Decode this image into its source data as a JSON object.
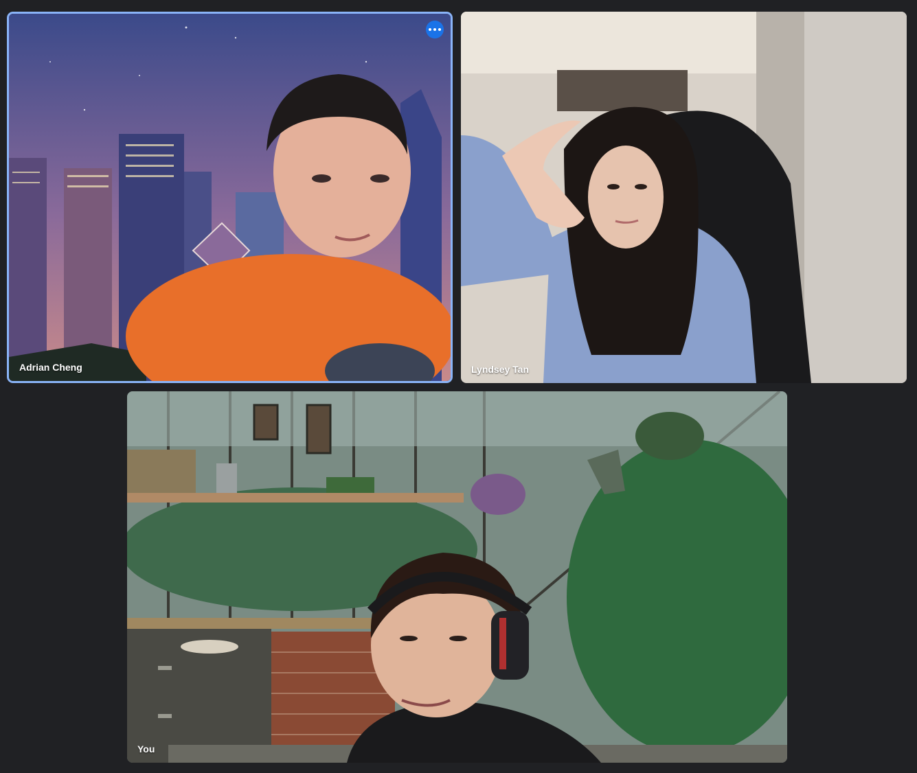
{
  "participants": [
    {
      "name": "Adrian Cheng",
      "pinned_menu_icon": "more-horiz-icon"
    },
    {
      "name": "Lyndsey Tan"
    },
    {
      "name": "You"
    }
  ],
  "colors": {
    "background": "#202124",
    "active_speaker_border": "#8ab4f8",
    "menu_button": "#1a73e8"
  }
}
